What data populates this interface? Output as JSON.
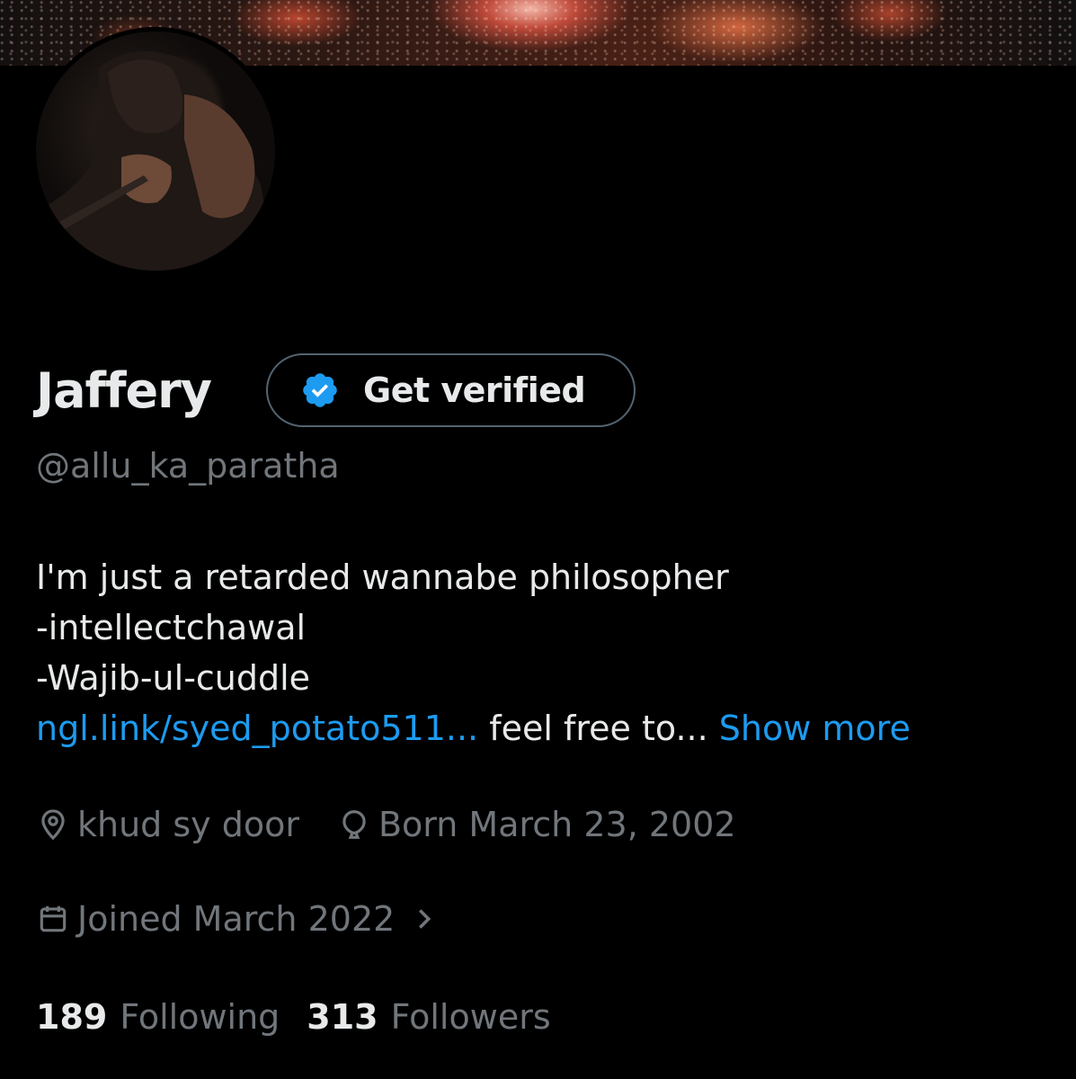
{
  "profile": {
    "name": "Jaffery",
    "handle": "@allu_ka_paratha",
    "get_verified_label": "Get verified",
    "bio_lines": [
      "I'm just a retarded wannabe philosopher",
      "-intellectchawal",
      "-Wajib-ul-cuddle"
    ],
    "bio_link": "ngl.link/syed_potato511...",
    "bio_tail": " feel free to...",
    "show_more_label": "Show more",
    "location": "khud sy door",
    "birthday": "Born March 23, 2002",
    "joined": "Joined March 2022",
    "following_count": "189",
    "following_label": "Following",
    "followers_count": "313",
    "followers_label": "Followers"
  },
  "icons": {
    "verified_badge": "verified-badge-icon",
    "location": "location-pin-icon",
    "birthday": "balloon-icon",
    "joined": "calendar-icon",
    "chevron": "chevron-right-icon"
  },
  "colors": {
    "background": "#000000",
    "primary_text": "#e7e9ea",
    "secondary_text": "#71767b",
    "link": "#1d9bf0",
    "border": "#536471"
  }
}
